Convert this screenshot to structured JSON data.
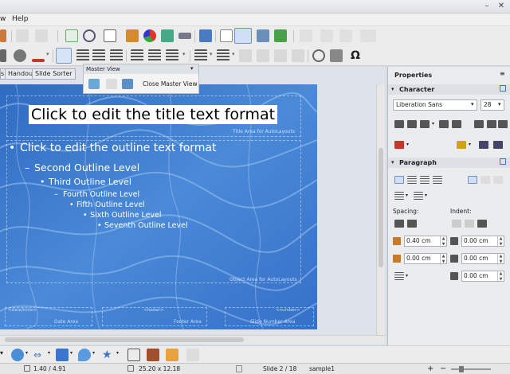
{
  "menu": {
    "items": [
      "w",
      "Help"
    ]
  },
  "window": {
    "close_glyph": "✕"
  },
  "view_tabs": [
    "s",
    "Handout",
    "Slide Sorter"
  ],
  "master_view": {
    "title": "Master View",
    "close_label": "Close Master View"
  },
  "slide": {
    "title_placeholder": "Click to edit the title text format",
    "title_area_label": "Title Area for AutoLayouts",
    "object_area_label": "Object Area for AutoLayouts",
    "outline": [
      {
        "text": "Click to edit the outline text format",
        "bullet": "•"
      },
      {
        "text": "Second Outline Level",
        "bullet": "–"
      },
      {
        "text": "Third Outline Level",
        "bullet": "•"
      },
      {
        "text": "Fourth Outline Level",
        "bullet": "–"
      },
      {
        "text": "Fifth Outline Level",
        "bullet": "•"
      },
      {
        "text": "Sixth Outline Level",
        "bullet": "•"
      },
      {
        "text": "Seventh Outline Level",
        "bullet": "•"
      }
    ],
    "footer": {
      "date_field": "<date/time>",
      "date_area": "Date Area",
      "footer_field": "<footer>",
      "footer_area": "Footer Area",
      "number_field": "<number>",
      "number_area": "Slide Number Area"
    }
  },
  "properties": {
    "title": "Properties",
    "character": {
      "section": "Character",
      "font_name": "Liberation Sans",
      "font_size": "28"
    },
    "paragraph": {
      "section": "Paragraph",
      "spacing_label": "Spacing:",
      "indent_label": "Indent:",
      "above_spacing": "0.40 cm",
      "below_spacing": "0.00 cm",
      "before_indent": "0.00 cm",
      "after_indent": "0.00 cm",
      "first_line_indent": "0.00 cm"
    }
  },
  "status": {
    "position": "1.40 / 4.91",
    "size": "25.20 x 12.18",
    "slide": "Slide 2 / 18",
    "master": "sample1",
    "zoom_minus": "−",
    "zoom_plus": "+"
  },
  "colors": {
    "accent": "#3a76cc",
    "font_color": "#c0392b",
    "highlight": "#f1c40f"
  }
}
